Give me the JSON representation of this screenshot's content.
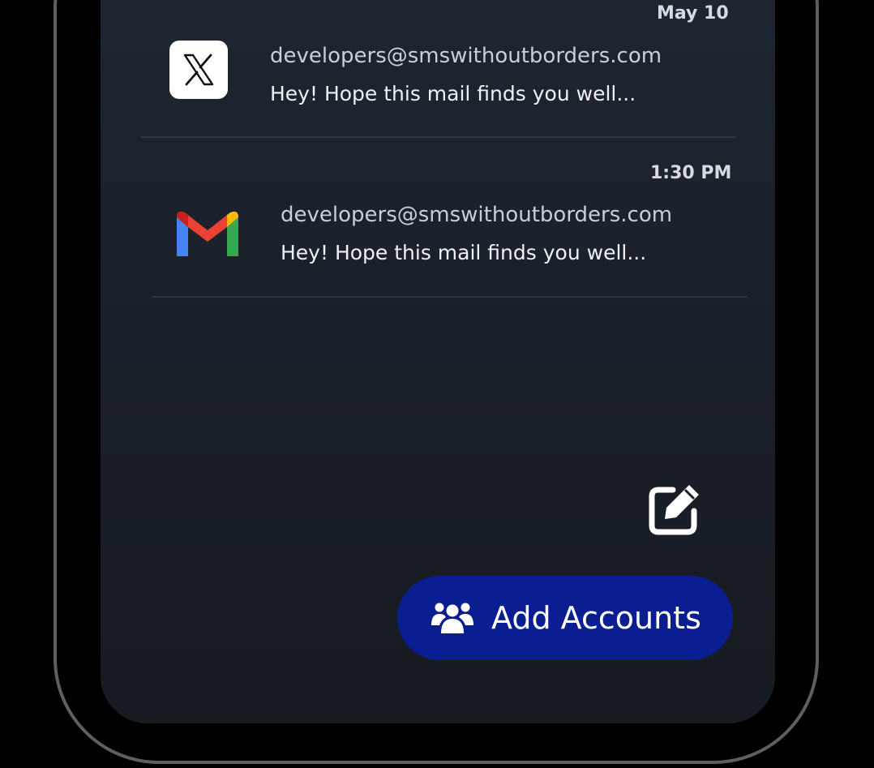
{
  "inbox": {
    "messages": [
      {
        "platform_icon": "x-logo-icon",
        "time": "May 10",
        "from": "developers@smswithoutborders.com",
        "snippet": "Hey! Hope this mail finds you well..."
      },
      {
        "platform_icon": "gmail-logo-icon",
        "time": "1:30 PM",
        "from": "developers@smswithoutborders.com",
        "snippet": "Hey! Hope this mail finds you well..."
      }
    ]
  },
  "actions": {
    "compose_icon": "compose-edit-icon",
    "add_accounts_icon": "users-group-icon",
    "add_accounts_label": "Add Accounts"
  },
  "colors": {
    "background": "#000000",
    "screen": "#1e2631",
    "accent_button": "#0b1e91",
    "divider": "#2b3947",
    "gmail_red": "#ea4335",
    "gmail_blue": "#4285f4",
    "gmail_green": "#34a853",
    "gmail_yellow": "#fbbc04"
  }
}
